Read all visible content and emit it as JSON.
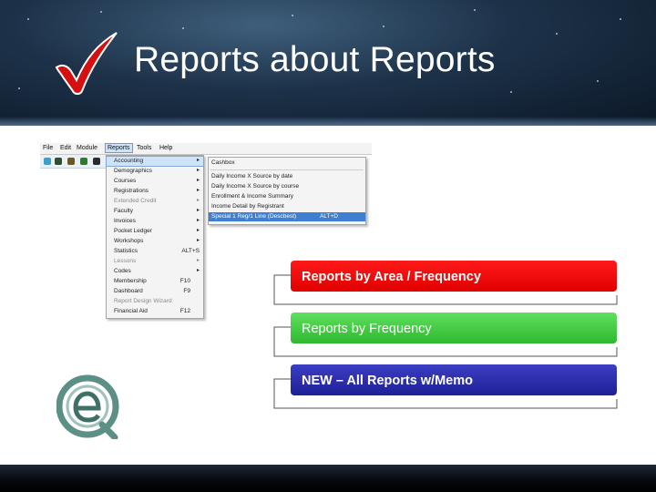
{
  "header": {
    "title": "Reports about Reports"
  },
  "app": {
    "menubar": [
      "File",
      "Edit",
      "Module",
      "Reports",
      "Tools",
      "Help"
    ],
    "reports_menu": [
      {
        "label": "Accounting",
        "shortcut": "",
        "submenu": true,
        "state": "selected"
      },
      {
        "label": "Demographics",
        "shortcut": "",
        "submenu": true,
        "state": "normal"
      },
      {
        "label": "Courses",
        "shortcut": "",
        "submenu": true,
        "state": "normal"
      },
      {
        "label": "Registrations",
        "shortcut": "",
        "submenu": true,
        "state": "normal"
      },
      {
        "label": "Extended Credit",
        "shortcut": "",
        "submenu": true,
        "state": "disabled"
      },
      {
        "label": "Faculty",
        "shortcut": "",
        "submenu": true,
        "state": "normal"
      },
      {
        "label": "Invoices",
        "shortcut": "",
        "submenu": true,
        "state": "normal"
      },
      {
        "label": "Pocket Ledger",
        "shortcut": "",
        "submenu": true,
        "state": "normal"
      },
      {
        "label": "Workshops",
        "shortcut": "",
        "submenu": true,
        "state": "normal"
      },
      {
        "label": "Statistics",
        "shortcut": "ALT+S",
        "submenu": false,
        "state": "normal"
      },
      {
        "label": "Lessons",
        "shortcut": "",
        "submenu": true,
        "state": "disabled"
      },
      {
        "label": "Codes",
        "shortcut": "",
        "submenu": true,
        "state": "normal"
      },
      {
        "label": "Membership",
        "shortcut": "F10",
        "submenu": false,
        "state": "normal"
      },
      {
        "label": "Dashboard",
        "shortcut": "F9",
        "submenu": false,
        "state": "normal"
      },
      {
        "label": "Report Design Wizard",
        "shortcut": "",
        "submenu": false,
        "state": "disabled"
      },
      {
        "label": "Financial Aid",
        "shortcut": "F12",
        "submenu": false,
        "state": "normal"
      }
    ],
    "accounting_menu": [
      {
        "label": "Cashbox",
        "shortcut": "",
        "state": "normal"
      },
      {
        "label": "Daily Income X Source by date",
        "shortcut": "",
        "state": "normal"
      },
      {
        "label": "Daily Income X Source by course",
        "shortcut": "",
        "state": "normal"
      },
      {
        "label": "Enrollment & Income Summary",
        "shortcut": "",
        "state": "normal"
      },
      {
        "label": "Income Detail by Registrant",
        "shortcut": "",
        "state": "normal"
      },
      {
        "label": "Special 1 Reg/1 Line (Descbest)",
        "shortcut": "ALT+D",
        "state": "selected"
      }
    ]
  },
  "report_options": [
    {
      "label": "Reports by Area /  Frequency",
      "color": "#ee0000"
    },
    {
      "label": "Reports by Frequency",
      "color": "#44cc44"
    },
    {
      "label": "NEW – All Reports w/Memo",
      "color": "#2b2da8"
    }
  ],
  "logo": {
    "name": "e-logo-icon"
  },
  "check": {
    "name": "checkmark-icon",
    "color": "#d41010"
  }
}
